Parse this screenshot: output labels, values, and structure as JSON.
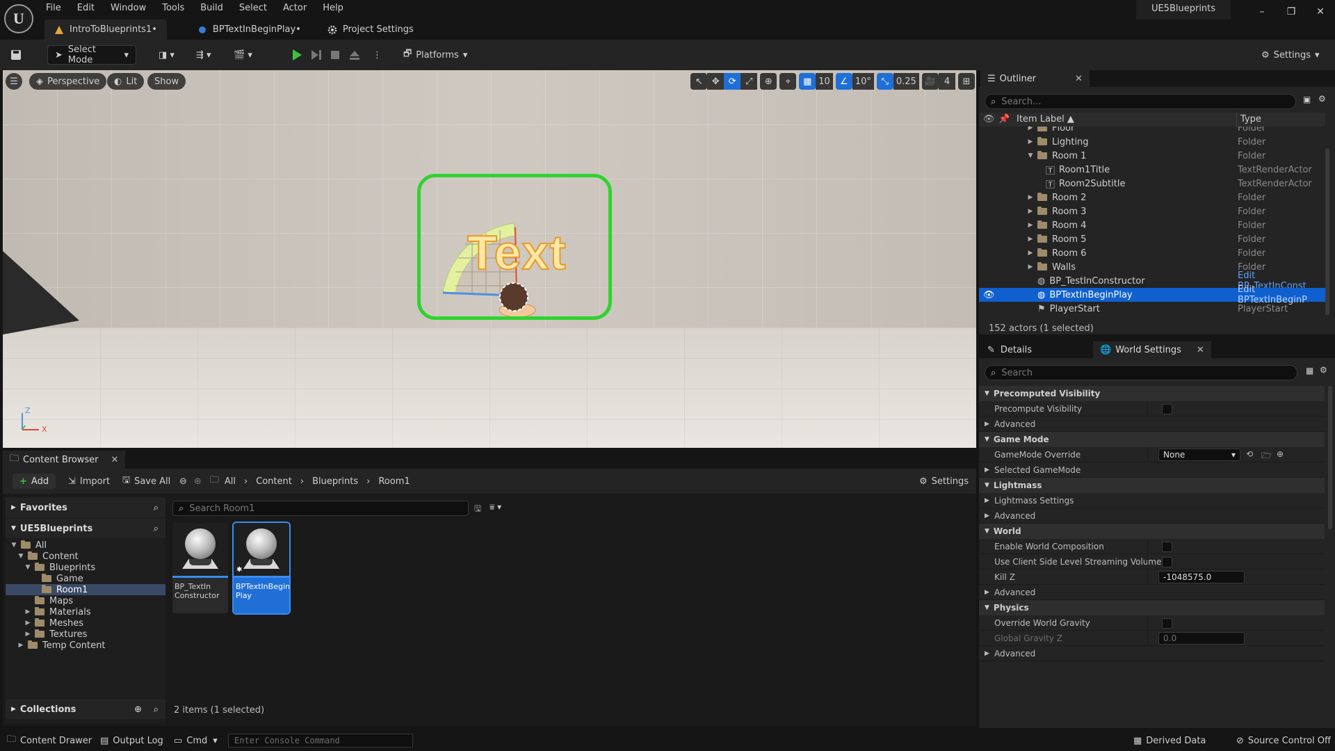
{
  "app": {
    "title": "UE5Blueprints"
  },
  "menu": [
    "File",
    "Edit",
    "Window",
    "Tools",
    "Build",
    "Select",
    "Actor",
    "Help"
  ],
  "tabs": [
    {
      "label": "IntroToBlueprints1•"
    },
    {
      "label": "BPTextInBeginPlay•"
    },
    {
      "label": "Project Settings"
    }
  ],
  "toolbar": {
    "mode": "Select Mode",
    "platforms": "Platforms",
    "settings": "Settings"
  },
  "viewport": {
    "perspective": "Perspective",
    "lit": "Lit",
    "show": "Show",
    "grid_snap": "10",
    "rot_snap": "10°",
    "scale_snap": "0.25",
    "camera_speed": "4",
    "text_actor": "Text",
    "axis_z": "Z",
    "axis_x": "X"
  },
  "outliner": {
    "title": "Outliner",
    "search_placeholder": "Search...",
    "col_label": "Item Label ▲",
    "col_type": "Type",
    "rows": [
      {
        "label": "Floor",
        "type": "Folder"
      },
      {
        "label": "Lighting",
        "type": "Folder"
      },
      {
        "label": "Room 1",
        "type": "Folder"
      },
      {
        "label": "Room1Title",
        "type": "TextRenderActor"
      },
      {
        "label": "Room2Subtitle",
        "type": "TextRenderActor"
      },
      {
        "label": "Room 2",
        "type": "Folder"
      },
      {
        "label": "Room 3",
        "type": "Folder"
      },
      {
        "label": "Room 4",
        "type": "Folder"
      },
      {
        "label": "Room 5",
        "type": "Folder"
      },
      {
        "label": "Room 6",
        "type": "Folder"
      },
      {
        "label": "Walls",
        "type": "Folder"
      },
      {
        "label": "BP_TestInConstructor",
        "type": "Edit BP_TextInConst"
      },
      {
        "label": "BPTextInBeginPlay",
        "type": "Edit BPTextInBeginP"
      },
      {
        "label": "PlayerStart",
        "type": "PlayerStart"
      }
    ],
    "footer": "152 actors (1 selected)"
  },
  "details": {
    "tab_details": "Details",
    "tab_world": "World Settings",
    "search_placeholder": "Search",
    "sections": {
      "precomputed": "Precomputed Visibility",
      "game_mode": "Game Mode",
      "lightmass": "Lightmass",
      "world": "World",
      "physics": "Physics"
    },
    "props": {
      "precompute_visibility": "Precompute Visibility",
      "advanced": "Advanced",
      "gamemode_override": "GameMode Override",
      "gamemode_value": "None",
      "selected_gamemode": "Selected GameMode",
      "lightmass_settings": "Lightmass Settings",
      "enable_world_composition": "Enable World Composition",
      "client_streaming": "Use Client Side Level Streaming Volumes",
      "kill_z": "Kill Z",
      "kill_z_value": "-1048575.0",
      "override_gravity": "Override World Gravity",
      "global_gravity": "Global Gravity Z",
      "global_gravity_value": "0.0"
    }
  },
  "content_browser": {
    "title": "Content Browser",
    "add": "Add",
    "import": "Import",
    "save_all": "Save All",
    "crumbs": [
      "All",
      "Content",
      "Blueprints",
      "Room1"
    ],
    "settings": "Settings",
    "favorites": "Favorites",
    "project": "UE5Blueprints",
    "search_placeholder": "Search Room1",
    "tree": [
      {
        "label": "All",
        "depth": 0
      },
      {
        "label": "Content",
        "depth": 1
      },
      {
        "label": "Blueprints",
        "depth": 2
      },
      {
        "label": "Game",
        "depth": 3
      },
      {
        "label": "Room1",
        "depth": 3
      },
      {
        "label": "Maps",
        "depth": 2
      },
      {
        "label": "Materials",
        "depth": 2
      },
      {
        "label": "Meshes",
        "depth": 2
      },
      {
        "label": "Textures",
        "depth": 2
      },
      {
        "label": "Temp Content",
        "depth": 1
      }
    ],
    "assets": [
      {
        "name": "BP_TextIn Constructor"
      },
      {
        "name": "BPTextInBegin Play"
      }
    ],
    "collections": "Collections",
    "footer": "2 items (1 selected)"
  },
  "status": {
    "content_drawer": "Content Drawer",
    "output_log": "Output Log",
    "cmd": "Cmd",
    "console_placeholder": "Enter Console Command",
    "derived_data": "Derived Data",
    "source_control": "Source Control Off"
  },
  "colors": {
    "accent": "#1f6fd6",
    "selection": "#2fd32f",
    "play": "#3fbf3f"
  }
}
